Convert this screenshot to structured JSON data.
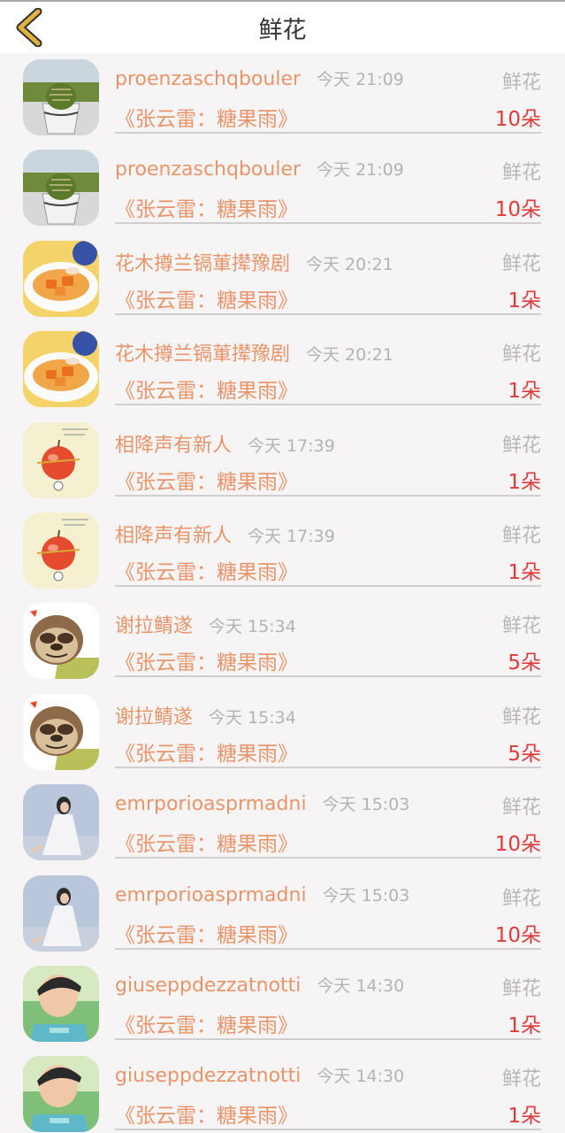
{
  "header": {
    "title": "鲜花",
    "back_icon": "chevron-left-icon",
    "accent": "#e2b240"
  },
  "colors": {
    "name": "#e8956a",
    "count": "#e03a3a",
    "muted": "#b3b3b3"
  },
  "records": [
    {
      "name": "proenzaschqbouler",
      "time": "今天 21:09",
      "kind": "鲜花",
      "song": "《张云雷：糖果雨》",
      "count": "10朵",
      "avatar": "cactus-avatar"
    },
    {
      "name": "proenzaschqbouler",
      "time": "今天 21:09",
      "kind": "鲜花",
      "song": "《张云雷：糖果雨》",
      "count": "10朵",
      "avatar": "cactus-avatar"
    },
    {
      "name": "花木撙兰镉莗撵豫剧",
      "time": "今天 20:21",
      "kind": "鲜花",
      "song": "《张云雷：糖果雨》",
      "count": "1朵",
      "avatar": "dessert-avatar"
    },
    {
      "name": "花木撙兰镉莗撵豫剧",
      "time": "今天 20:21",
      "kind": "鲜花",
      "song": "《张云雷：糖果雨》",
      "count": "1朵",
      "avatar": "dessert-avatar"
    },
    {
      "name": "相降声有新人",
      "time": "今天 17:39",
      "kind": "鲜花",
      "song": "《张云雷：糖果雨》",
      "count": "1朵",
      "avatar": "apple-avatar"
    },
    {
      "name": "相降声有新人",
      "time": "今天 17:39",
      "kind": "鲜花",
      "song": "《张云雷：糖果雨》",
      "count": "1朵",
      "avatar": "apple-avatar"
    },
    {
      "name": "谢拉鲭遂",
      "time": "今天 15:34",
      "kind": "鲜花",
      "song": "《张云雷：糖果雨》",
      "count": "5朵",
      "avatar": "sloth-avatar"
    },
    {
      "name": "谢拉鲭遂",
      "time": "今天 15:34",
      "kind": "鲜花",
      "song": "《张云雷：糖果雨》",
      "count": "5朵",
      "avatar": "sloth-avatar"
    },
    {
      "name": "emrporioasprmadni",
      "time": "今天 15:03",
      "kind": "鲜花",
      "song": "《张云雷：糖果雨》",
      "count": "10朵",
      "avatar": "girl-avatar"
    },
    {
      "name": "emrporioasprmadni",
      "time": "今天 15:03",
      "kind": "鲜花",
      "song": "《张云雷：糖果雨》",
      "count": "10朵",
      "avatar": "girl-avatar"
    },
    {
      "name": "giuseppdezzatnotti",
      "time": "今天 14:30",
      "kind": "鲜花",
      "song": "《张云雷：糖果雨》",
      "count": "1朵",
      "avatar": "boy-avatar"
    },
    {
      "name": "giuseppdezzatnotti",
      "time": "今天 14:30",
      "kind": "鲜花",
      "song": "《张云雷：糖果雨》",
      "count": "1朵",
      "avatar": "boy-avatar"
    }
  ]
}
